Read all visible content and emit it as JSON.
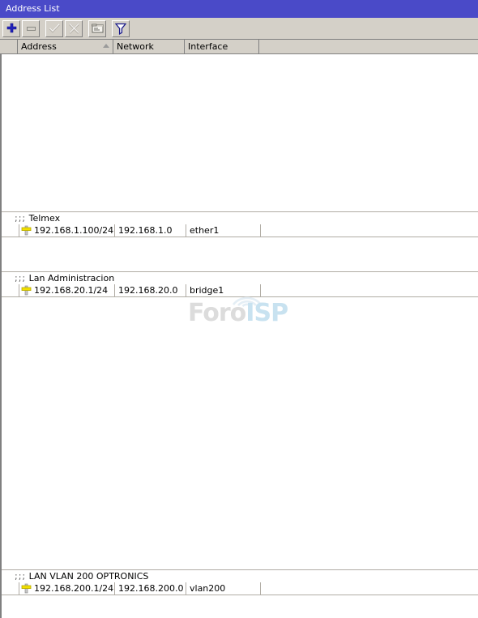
{
  "window": {
    "title": "Address List"
  },
  "toolbar": {
    "buttons": [
      {
        "name": "add-button",
        "icon": "plus-icon",
        "label": "Add",
        "enabled": true
      },
      {
        "name": "remove-button",
        "icon": "minus-icon",
        "label": "Remove",
        "enabled": false
      },
      {
        "name": "enable-button",
        "icon": "check-icon",
        "label": "Enable",
        "enabled": false
      },
      {
        "name": "disable-button",
        "icon": "cross-icon",
        "label": "Disable",
        "enabled": false
      },
      {
        "name": "comment-button",
        "icon": "comment-icon",
        "label": "Comment",
        "enabled": true
      },
      {
        "name": "filter-button",
        "icon": "funnel-icon",
        "label": "Filter",
        "enabled": true
      }
    ]
  },
  "table": {
    "columns": [
      {
        "key": "flag",
        "label": ""
      },
      {
        "key": "address",
        "label": "Address",
        "sorted": "ascending"
      },
      {
        "key": "network",
        "label": "Network"
      },
      {
        "key": "interface",
        "label": "Interface"
      },
      {
        "key": "rest",
        "label": ""
      }
    ],
    "groups": [
      {
        "comment_prefix": ";;;",
        "comment": "Telmex",
        "rows": [
          {
            "icon": "address-icon",
            "address": "192.168.1.100/24",
            "network": "192.168.1.0",
            "interface": "ether1"
          }
        ]
      },
      {
        "comment_prefix": ";;;",
        "comment": "Lan Administracion",
        "rows": [
          {
            "icon": "address-icon",
            "address": "192.168.20.1/24",
            "network": "192.168.20.0",
            "interface": "bridge1"
          }
        ]
      },
      {
        "comment_prefix": ";;;",
        "comment": "LAN VLAN 200 OPTRONICS",
        "rows": [
          {
            "icon": "address-icon",
            "address": "192.168.200.1/24",
            "network": "192.168.200.0",
            "interface": "vlan200"
          }
        ]
      }
    ]
  },
  "watermark": {
    "text_primary": "Foro",
    "text_accent": "ISP",
    "color_primary": "#dcdcdc",
    "color_accent": "#c8e2f0"
  },
  "colors": {
    "titlebar": "#4a4ac8",
    "chrome": "#d4d0c8",
    "grid_line": "#b0aca4",
    "accent_plus": "#2222bb",
    "address_icon": "#e8d000"
  }
}
